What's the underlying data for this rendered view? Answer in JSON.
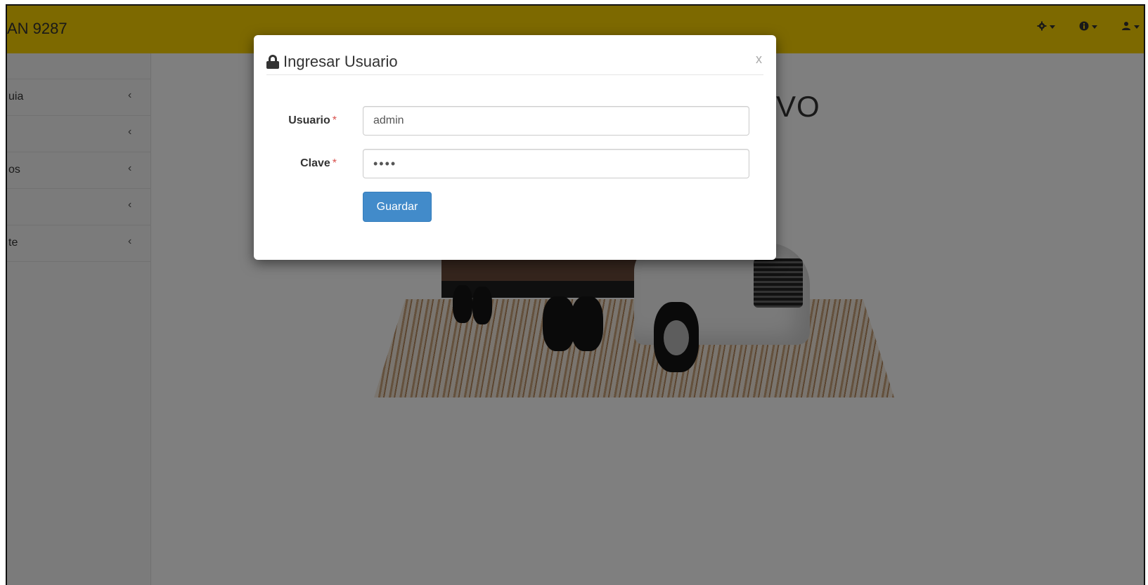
{
  "app": {
    "brand": "AN 9287",
    "nav": [
      {
        "icon": "gear-icon"
      },
      {
        "icon": "info-icon"
      },
      {
        "icon": "user-icon"
      }
    ]
  },
  "sidebar": {
    "items": [
      {
        "label": "uia"
      },
      {
        "label": ""
      },
      {
        "label": "os"
      },
      {
        "label": ""
      },
      {
        "label": "te"
      }
    ]
  },
  "main": {
    "hero_title": "VO"
  },
  "modal": {
    "title": "Ingresar Usuario",
    "close_label": "x",
    "fields": {
      "usuario": {
        "label": "Usuario",
        "required_mark": "*",
        "value": "admin"
      },
      "clave": {
        "label": "Clave",
        "required_mark": "*",
        "value": "••••"
      }
    },
    "save_label": "Guardar"
  },
  "colors": {
    "topbar": "#fbd200",
    "primary_button": "#428bca",
    "required": "#d9534f"
  }
}
